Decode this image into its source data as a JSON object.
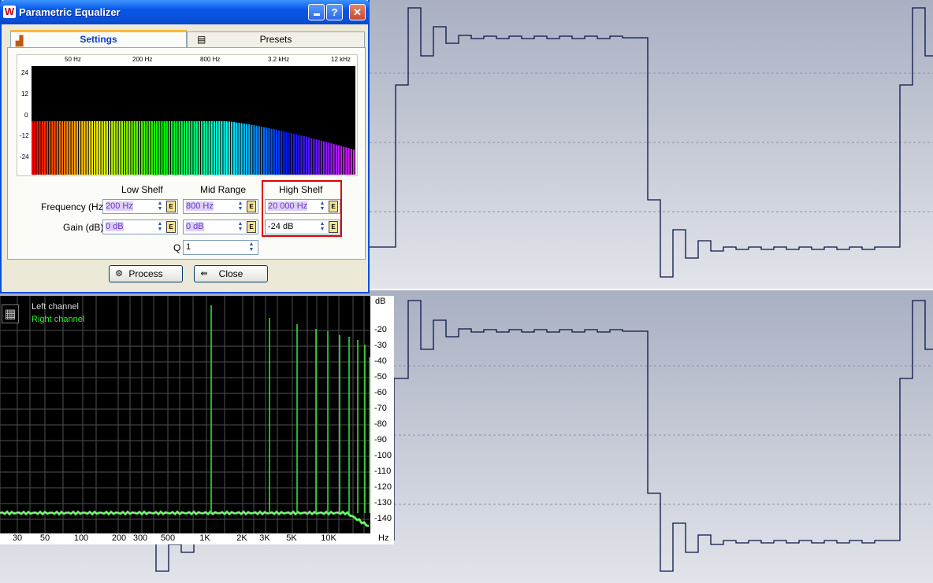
{
  "window": {
    "title": "Parametric Equalizer",
    "icon": "wavelab-logo-icon",
    "controls": [
      "minimize",
      "help",
      "close"
    ],
    "help_label": "?"
  },
  "tabs": [
    {
      "label": "Settings",
      "icon": "spectrum-icon",
      "active": true
    },
    {
      "label": "Presets",
      "icon": "presets-icon",
      "active": false
    }
  ],
  "eq_display": {
    "freq_labels": [
      "50 Hz",
      "200 Hz",
      "800 Hz",
      "3.2 kHz",
      "12 kHz"
    ],
    "gain_labels": [
      "24",
      "12",
      "0",
      "-12",
      "-24"
    ]
  },
  "bands": {
    "low_shelf": {
      "header": "Low Shelf",
      "frequency": "200 Hz",
      "gain": "0 dB"
    },
    "mid_range": {
      "header": "Mid Range",
      "frequency": "800 Hz",
      "gain": "0 dB"
    },
    "high_shelf": {
      "header": "High Shelf",
      "frequency": "20 000 Hz",
      "gain": "-24 dB"
    }
  },
  "labels": {
    "frequency": "Frequency (Hz)",
    "gain": "Gain (dB)",
    "q": "Q"
  },
  "q_value": "1",
  "buttons": {
    "process": "Process",
    "close": "Close"
  },
  "analyzer": {
    "legend": {
      "left": "Left channel",
      "right": "Right channel"
    },
    "db_unit": "dB",
    "db_ticks": [
      "-20",
      "-30",
      "-40",
      "-50",
      "-60",
      "-70",
      "-80",
      "-90",
      "-100",
      "-110",
      "-120",
      "-130",
      "-140"
    ],
    "freq_ticks": [
      "30",
      "50",
      "100",
      "200",
      "300",
      "500",
      "1K",
      "2K",
      "3K",
      "5K",
      "10K"
    ],
    "freq_unit": "Hz"
  },
  "colors": {
    "accent": "#0a4fd8",
    "highlight": "#e00000",
    "right_channel": "#33ee33"
  }
}
